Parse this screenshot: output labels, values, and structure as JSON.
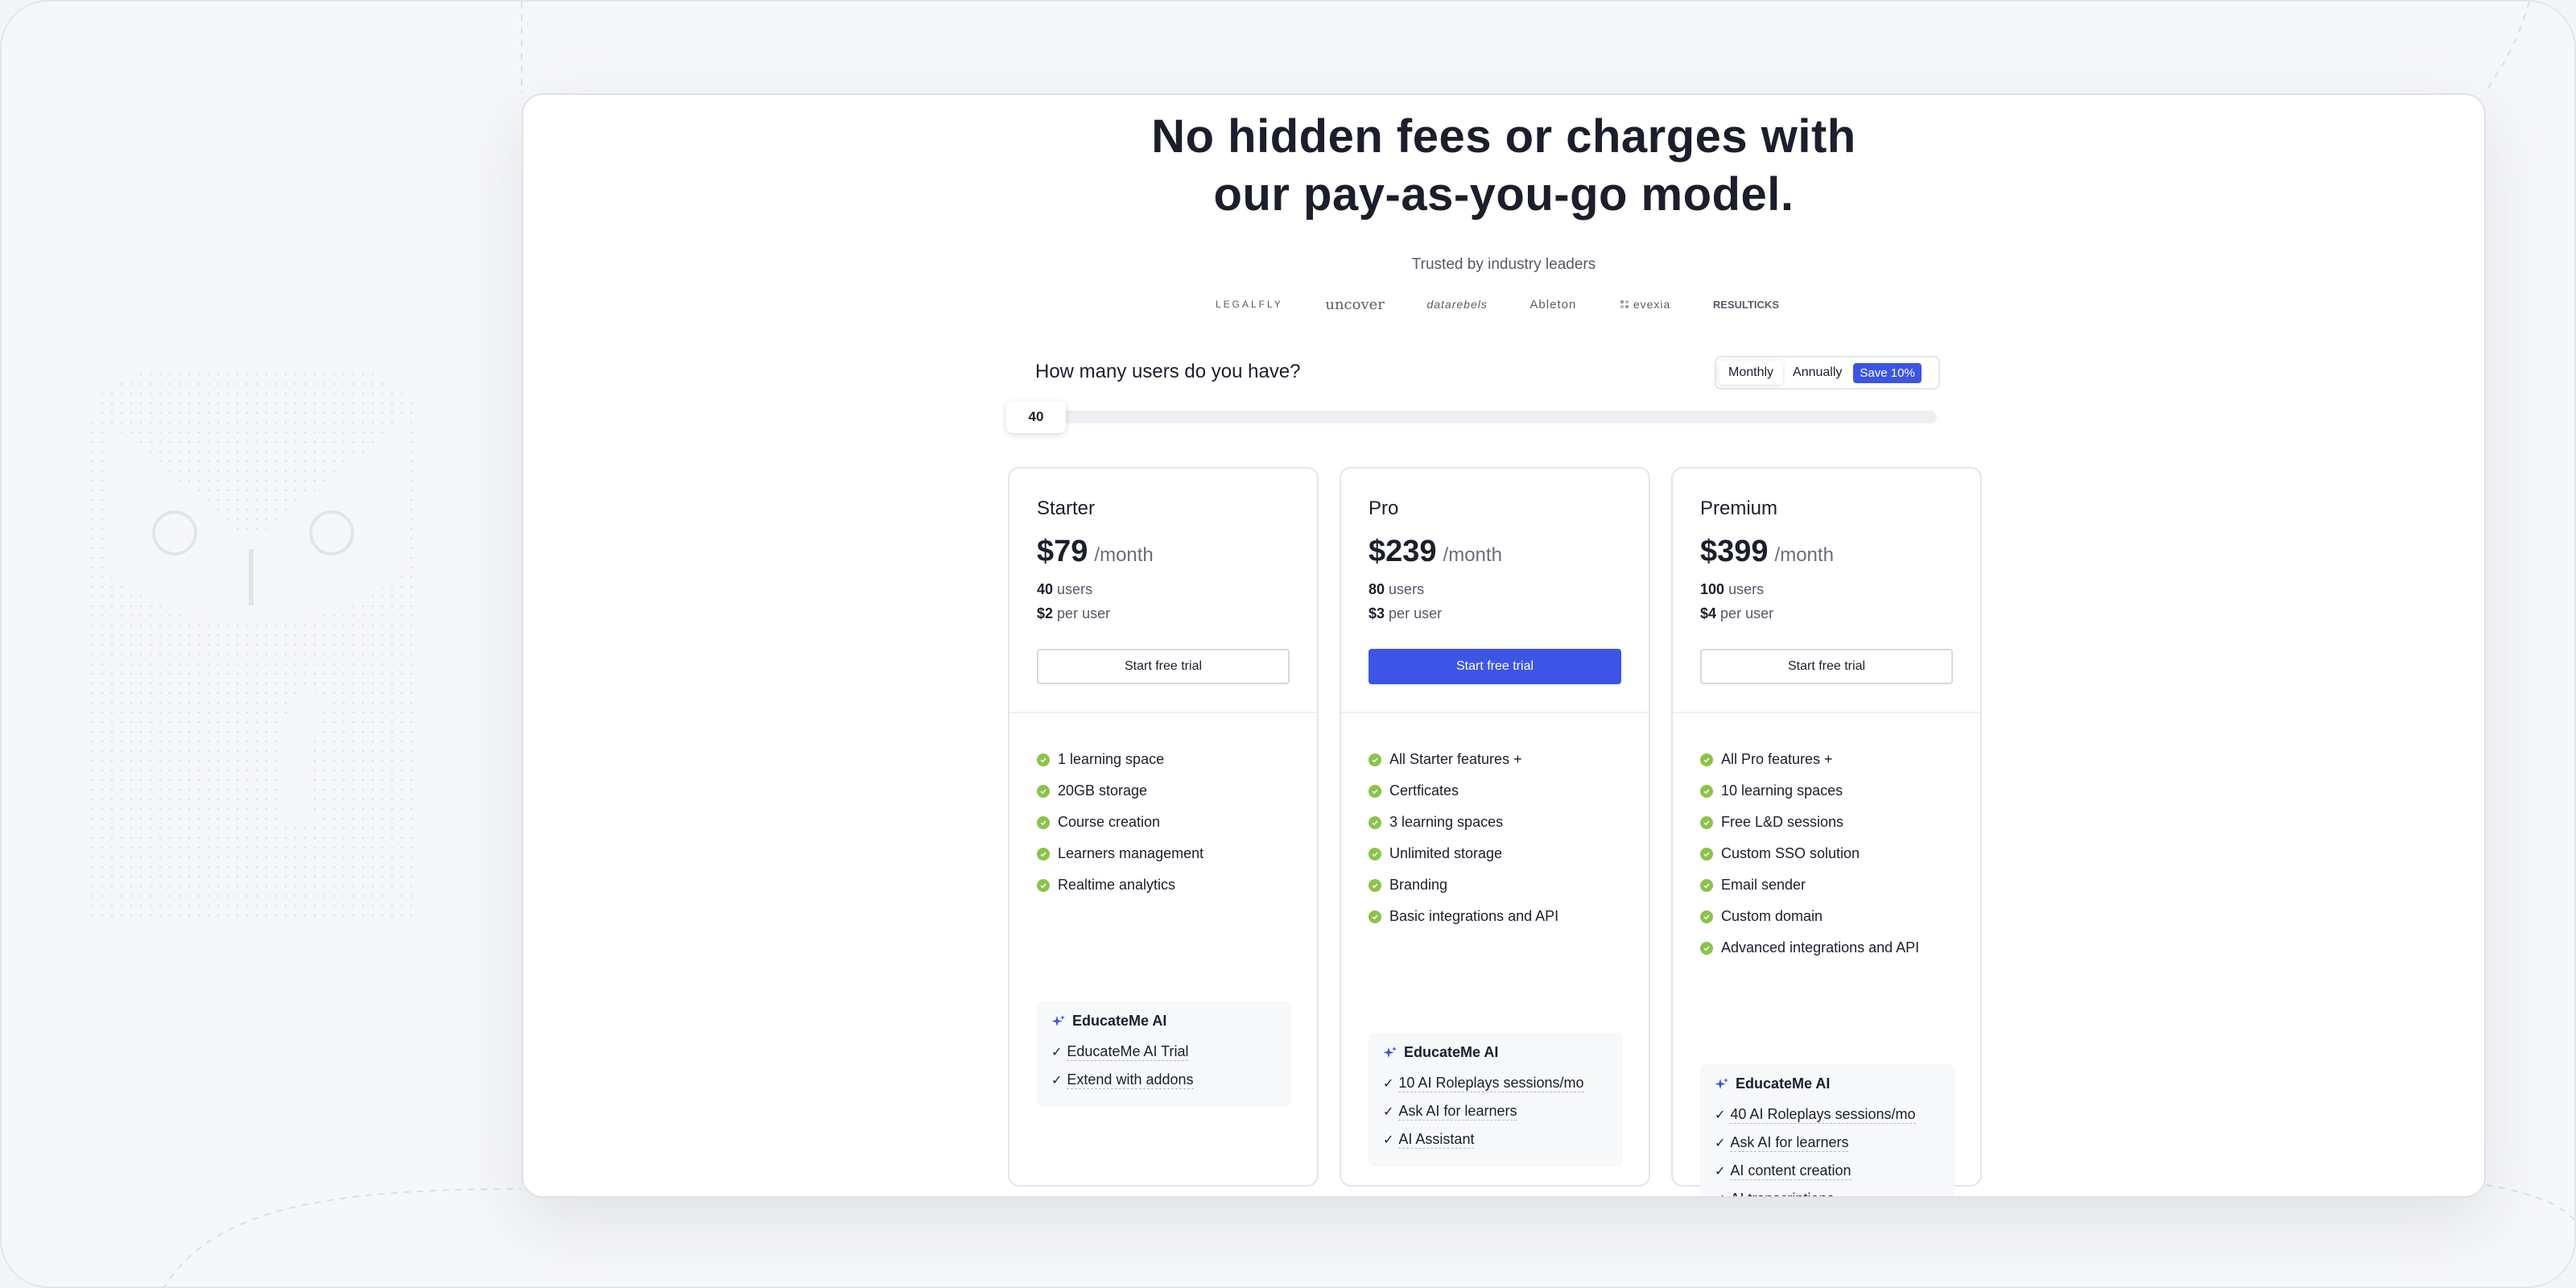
{
  "headline": {
    "line1": "No hidden fees or charges with",
    "line2": "our pay-as-you-go model."
  },
  "trusted_label": "Trusted by industry leaders",
  "logos": [
    "LEGALFLY",
    "uncover",
    "datarebels",
    "Ableton",
    "evexia",
    "RESULTICKS"
  ],
  "users_question": "How many users do you have?",
  "billing": {
    "monthly": "Monthly",
    "annually": "Annually",
    "save_badge": "Save 10%",
    "selected": "Monthly"
  },
  "slider": {
    "value": "40"
  },
  "plans": [
    {
      "name": "Starter",
      "price": "$79",
      "period": "/month",
      "users_count": "40",
      "users_label": "users",
      "per_user_price": "$2",
      "per_user_label": "per user",
      "cta": "Start free trial",
      "features": [
        "1 learning space",
        "20GB storage",
        "Course creation",
        "Learners management",
        "Realtime analytics"
      ],
      "ai_title": "EducateMe AI",
      "ai_items": [
        "EducateMe AI Trial",
        "Extend with addons"
      ]
    },
    {
      "name": "Pro",
      "price": "$239",
      "period": "/month",
      "users_count": "80",
      "users_label": "users",
      "per_user_price": "$3",
      "per_user_label": "per user",
      "cta": "Start free trial",
      "features": [
        "All Starter features +",
        "Certficates",
        "3 learning spaces",
        "Unlimited storage",
        "Branding",
        "Basic integrations  and API"
      ],
      "ai_title": "EducateMe AI",
      "ai_items": [
        "10 AI Roleplays sessions/mo",
        "Ask AI for learners",
        "AI Assistant"
      ]
    },
    {
      "name": "Premium",
      "price": "$399",
      "period": "/month",
      "users_count": "100",
      "users_label": "users",
      "per_user_price": "$4",
      "per_user_label": "per user",
      "cta": "Start free trial",
      "features": [
        "All Pro features +",
        "10 learning spaces",
        "Free L&D sessions",
        "Custom SSO solution",
        "Email sender",
        "Custom domain",
        "Advanced integrations and API"
      ],
      "ai_title": "EducateMe AI",
      "ai_items": [
        "40 AI Roleplays sessions/mo",
        "Ask AI for learners",
        "AI content creation",
        "AI transcriptions"
      ]
    }
  ],
  "colors": {
    "accent": "#3d55e6",
    "check": "#8bc34a",
    "text": "#1c1e2b"
  }
}
